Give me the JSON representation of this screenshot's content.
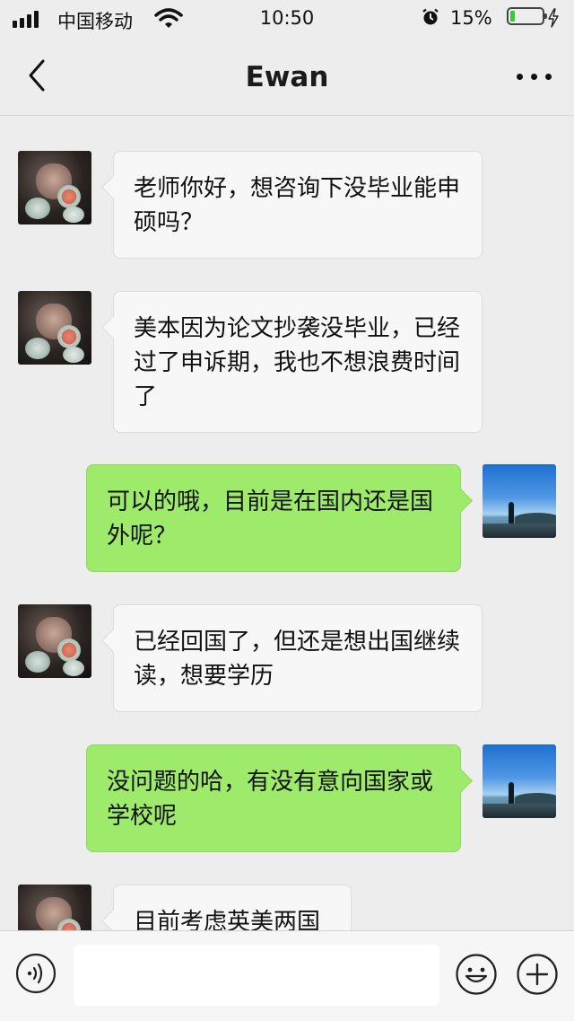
{
  "status_bar": {
    "carrier": "中国移动",
    "time": "10:50",
    "battery_percent": "15%",
    "battery_level": 0.15,
    "icons": [
      "signal-icon",
      "wifi-icon",
      "alarm-icon",
      "battery-icon",
      "charging-bolt-icon"
    ]
  },
  "nav": {
    "title": "Ewan",
    "back_icon": "chevron-left-icon",
    "more_icon": "more-dots-icon"
  },
  "messages": [
    {
      "direction": "in",
      "text": "老师你好，想咨询下没毕业能申硕吗？"
    },
    {
      "direction": "in",
      "text": "美本因为论文抄袭没毕业，已经过了申诉期，我也不想浪费时间了"
    },
    {
      "direction": "out",
      "text": "可以的哦，目前是在国内还是国外呢？"
    },
    {
      "direction": "in",
      "text": "已经回国了，但还是想出国继续读，想要学历"
    },
    {
      "direction": "out",
      "text": "没问题的哈，有没有意向国家或学校呢"
    },
    {
      "direction": "in",
      "text": "目前考虑英美两国"
    }
  ],
  "input_bar": {
    "placeholder": "",
    "icons": [
      "voice-icon",
      "emoji-icon",
      "plus-icon"
    ]
  },
  "colors": {
    "background": "#ededed",
    "incoming_bubble": "#f7f7f7",
    "outgoing_bubble": "#9eea6a",
    "battery_fill": "#3fc43f"
  }
}
